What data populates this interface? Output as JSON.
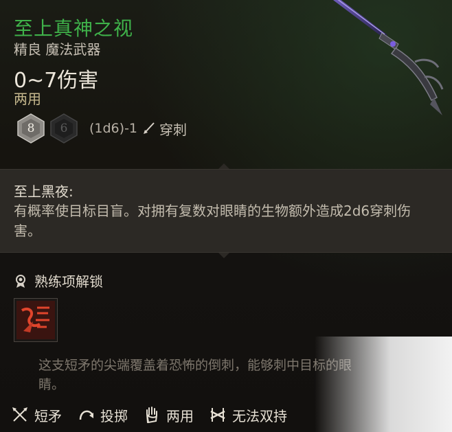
{
  "item": {
    "name": "至上真神之视",
    "rarity_type": "精良 魔法武器",
    "damage": "0~7伤害",
    "handedness": "两用",
    "dice": {
      "primary": "8",
      "secondary": "6",
      "formula": "(1d6)-1",
      "damage_type": "穿刺"
    }
  },
  "passive": {
    "title": "至上黑夜:",
    "description": "有概率使目标目盲。对拥有复数对眼睛的生物额外造成2d6穿刺伤害。"
  },
  "proficiency": {
    "label": "熟练项解锁"
  },
  "flavor_text": "这支短矛的尖端覆盖着恐怖的倒刺，能够刺中目标的眼睛。",
  "properties": [
    {
      "label": "短矛",
      "icon": "crossed-spears-icon"
    },
    {
      "label": "投掷",
      "icon": "throw-arc-icon"
    },
    {
      "label": "两用",
      "icon": "hand-icon"
    },
    {
      "label": "无法双持",
      "icon": "no-dual-wield-icon"
    }
  ],
  "colors": {
    "item_name": "#3fb24a",
    "passive_bg": "#2c2925",
    "background": "#141210"
  }
}
